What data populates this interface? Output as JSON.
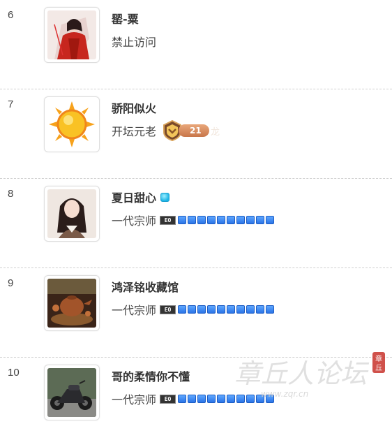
{
  "ranking": [
    {
      "rank": "6",
      "name": "罂-粟",
      "title": "禁止访问",
      "avatar_icon": "avatar-woman-red-robe-icon"
    },
    {
      "rank": "7",
      "name": "骄阳似火",
      "title": "开坛元老",
      "avatar_icon": "avatar-sun-icon",
      "medal_value": "21",
      "medal_text": "龙"
    },
    {
      "rank": "8",
      "name": "夏日甜心",
      "title": "一代宗师",
      "avatar_icon": "avatar-girl-icon"
    },
    {
      "rank": "9",
      "name": "鸿泽铭收藏馆",
      "title": "一代宗师",
      "avatar_icon": "avatar-teapot-icon"
    },
    {
      "rank": "10",
      "name": "哥的柔情你不懂",
      "title": "一代宗师",
      "avatar_icon": "avatar-motorcycle-icon"
    }
  ],
  "level_badge": "EO",
  "watermark": {
    "logo_text": "章丘人论坛",
    "url": "www.zqr.cn",
    "seal": "章丘"
  }
}
